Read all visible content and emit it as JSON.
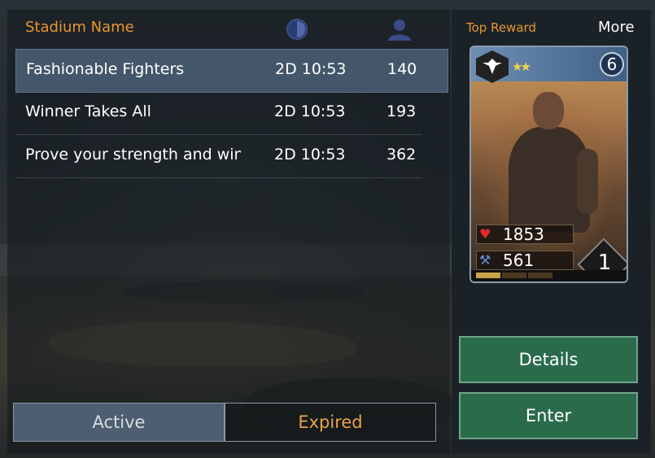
{
  "header": {
    "name_col": "Stadium Name",
    "time_icon": "clock-icon",
    "players_icon": "user-icon"
  },
  "stadiums": [
    {
      "name": "Fashionable Fighters",
      "time": "2D 10:53",
      "count": "140",
      "selected": true
    },
    {
      "name": "Winner Takes All",
      "time": "2D 10:53",
      "count": "193",
      "selected": false
    },
    {
      "name": "Prove your strength and win f",
      "time": "2D 10:53",
      "count": "362",
      "selected": false
    }
  ],
  "tabs": {
    "active": "Active",
    "expired": "Expired"
  },
  "reward": {
    "title": "Top Reward",
    "more": "More",
    "card": {
      "cost": "6",
      "stars": "★★",
      "hp": "1853",
      "attack": "561",
      "level": "1",
      "faction_icon": "eagle-emblem-icon",
      "hp_icon": "heart-icon",
      "attack_icon": "crossed-hammers-icon"
    }
  },
  "buttons": {
    "details": "Details",
    "enter": "Enter"
  },
  "colors": {
    "accent_orange": "#e8962e",
    "button_green": "#2a6b4c",
    "selected_row": "#44576a"
  }
}
